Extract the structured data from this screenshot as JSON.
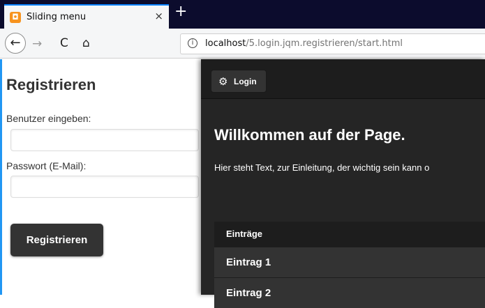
{
  "browser": {
    "tab_title": "Sliding menu",
    "tab_close": "×",
    "new_tab": "+",
    "back": "←",
    "forward": "→",
    "reload": "C",
    "home": "⌂",
    "info": "i",
    "url_host": "localhost",
    "url_path": "/5.login.jqm.registrieren/start.html"
  },
  "panel": {
    "title": "Registrieren",
    "user_label": "Benutzer eingeben:",
    "user_value": "",
    "pass_label": "Passwort (E-Mail):",
    "pass_value": "",
    "submit_label": "Registrieren"
  },
  "main": {
    "login_label": "Login",
    "welcome": "Willkommen auf der Page.",
    "intro": "Hier steht Text, zur Einleitung, der wichtig sein kann o",
    "list_divider": "Einträge",
    "items": [
      "Eintrag 1",
      "Eintrag 2"
    ]
  },
  "colors": {
    "accent_blue": "#2196f3",
    "page_dark": "#252525",
    "header_dark": "#1d1d1d",
    "button_dark": "#333333"
  }
}
